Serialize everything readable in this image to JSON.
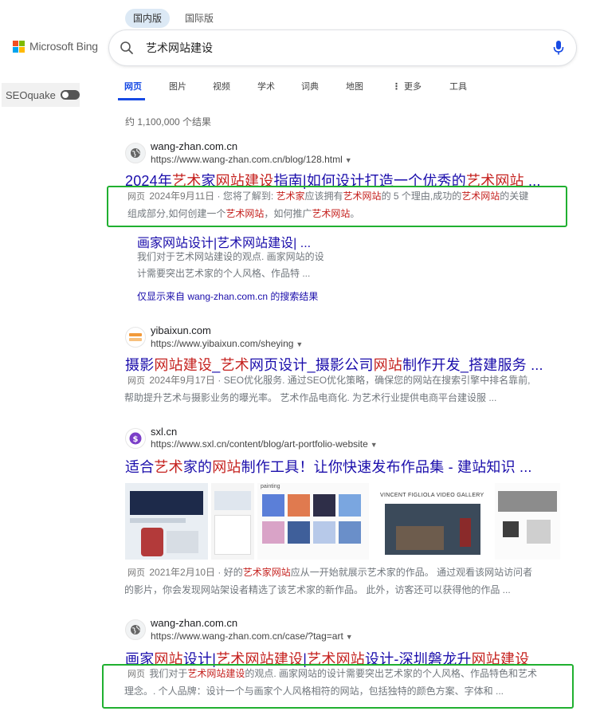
{
  "region_tabs": [
    {
      "label": "国内版",
      "active": true
    },
    {
      "label": "国际版",
      "active": false
    }
  ],
  "logo": {
    "text": "Microsoft Bing"
  },
  "search": {
    "value": "艺术网站建设"
  },
  "seoquake": {
    "label": "SEOquake"
  },
  "nav": {
    "items": [
      "网页",
      "图片",
      "视频",
      "学术",
      "词典",
      "地图",
      "更多",
      "工具"
    ],
    "more_icon": "vertical-dots-icon"
  },
  "result_count": "约 1,100,000 个结果",
  "results": [
    {
      "site_name": "wang-zhan.com.cn",
      "url": "https://www.wang-zhan.com.cn/blog/128.html",
      "title_parts": [
        {
          "t": "2024年",
          "hl": false
        },
        {
          "t": "艺术",
          "hl": true
        },
        {
          "t": "家",
          "hl": false
        },
        {
          "t": "网站建设",
          "hl": true
        },
        {
          "t": "指南|如何设计打造一个优秀的",
          "hl": false
        },
        {
          "t": "艺术网站",
          "hl": true
        },
        {
          "t": " ...",
          "hl": false
        }
      ],
      "snippet_tag": "网页",
      "snippet_date": "2024年9月11日",
      "snippet_line1": [
        {
          "t": "您将了解到: ",
          "hl": false
        },
        {
          "t": "艺术家",
          "hl": true
        },
        {
          "t": "应该拥有",
          "hl": false
        },
        {
          "t": "艺术网站",
          "hl": true
        },
        {
          "t": "的 5 个理由,成功的",
          "hl": false
        },
        {
          "t": "艺术网站",
          "hl": true
        },
        {
          "t": "的关键",
          "hl": false
        }
      ],
      "snippet_line2": [
        {
          "t": "组成部分,如何创建一个",
          "hl": false
        },
        {
          "t": "艺术网站",
          "hl": true
        },
        {
          "t": "，如何推广",
          "hl": false
        },
        {
          "t": "艺术网站",
          "hl": true
        },
        {
          "t": "。",
          "hl": false
        }
      ],
      "deep_link": {
        "title": "画家网站设计|艺术网站建设| ...",
        "snippet_line1": "我们对于艺术网站建设的观点. 画家网站的设",
        "snippet_line2": "计需要突出艺术家的个人风格、作品特 ...",
        "more": "仅显示来自 wang-zhan.com.cn 的搜索结果"
      }
    },
    {
      "site_name": "yibaixun.com",
      "url": "https://www.yibaixun.com/sheying",
      "title_parts": [
        {
          "t": "摄影",
          "hl": false
        },
        {
          "t": "网站建设",
          "hl": true
        },
        {
          "t": "_",
          "hl": false
        },
        {
          "t": "艺术",
          "hl": true
        },
        {
          "t": "网页设计_摄影公司",
          "hl": false
        },
        {
          "t": "网站",
          "hl": true
        },
        {
          "t": "制作开发_搭建服务 ...",
          "hl": false
        }
      ],
      "snippet_tag": "网页",
      "snippet_date": "2024年9月17日",
      "snippet_line1": [
        {
          "t": "SEO优化服务. 通过SEO优化策略，确保您的网站在搜索引擎中排名靠前,",
          "hl": false
        }
      ],
      "snippet_line2": [
        {
          "t": "帮助提升艺术与摄影业务的曝光率。 艺术作品电商化. 为艺术行业提供电商平台建设服 ...",
          "hl": false
        }
      ]
    },
    {
      "site_name": "sxl.cn",
      "url": "https://www.sxl.cn/content/blog/art-portfolio-website",
      "title_parts": [
        {
          "t": "适合",
          "hl": false
        },
        {
          "t": "艺术",
          "hl": true
        },
        {
          "t": "家的",
          "hl": false
        },
        {
          "t": "网站",
          "hl": true
        },
        {
          "t": "制作工具！让你快速发布作品集 - 建站知识 ...",
          "hl": false
        }
      ],
      "images": [
        {
          "caption": "",
          "label": ""
        },
        {
          "caption": "painting",
          "label": ""
        },
        {
          "caption": "VINCENT FIGLIOLA VIDEO GALLERY",
          "label": ""
        },
        {
          "caption": "",
          "label": ""
        }
      ],
      "snippet_tag": "网页",
      "snippet_date": "2021年2月10日",
      "snippet_line1": [
        {
          "t": "好的",
          "hl": false
        },
        {
          "t": "艺术家网站",
          "hl": true
        },
        {
          "t": "应从一开始就展示艺术家的作品。 通过观看该网站访问者",
          "hl": false
        }
      ],
      "snippet_line2": [
        {
          "t": "的影片，你会发现网站架设者精选了该艺术家的新作品。 此外，访客还可以获得他的作品 ...",
          "hl": false
        }
      ]
    },
    {
      "site_name": "wang-zhan.com.cn",
      "url": "https://www.wang-zhan.com.cn/case/?tag=art",
      "title_parts": [
        {
          "t": "画家",
          "hl": false
        },
        {
          "t": "网站",
          "hl": true
        },
        {
          "t": "设计|",
          "hl": false
        },
        {
          "t": "艺术网站建设",
          "hl": true
        },
        {
          "t": "|",
          "hl": false
        },
        {
          "t": "艺术网站",
          "hl": true
        },
        {
          "t": "设计-深圳磐龙升",
          "hl": false
        },
        {
          "t": "网站建设",
          "hl": true
        }
      ],
      "snippet_tag": "网页",
      "snippet_line1": [
        {
          "t": "我们对于",
          "hl": false
        },
        {
          "t": "艺术网站建设",
          "hl": true
        },
        {
          "t": "的观点. 画家网站的设计需要突出艺术家的个人风格、作品特色和艺术",
          "hl": false
        }
      ],
      "snippet_line2": [
        {
          "t": "理念。. 个人品牌：设计一个与画家个人风格相符的网站，包括独特的颜色方案、字体和 ...",
          "hl": false
        }
      ]
    }
  ],
  "colors": {
    "link": "#1a0dab",
    "highlight": "#c5221f",
    "accent": "#174ae4",
    "annotation_box": "#20b030"
  }
}
